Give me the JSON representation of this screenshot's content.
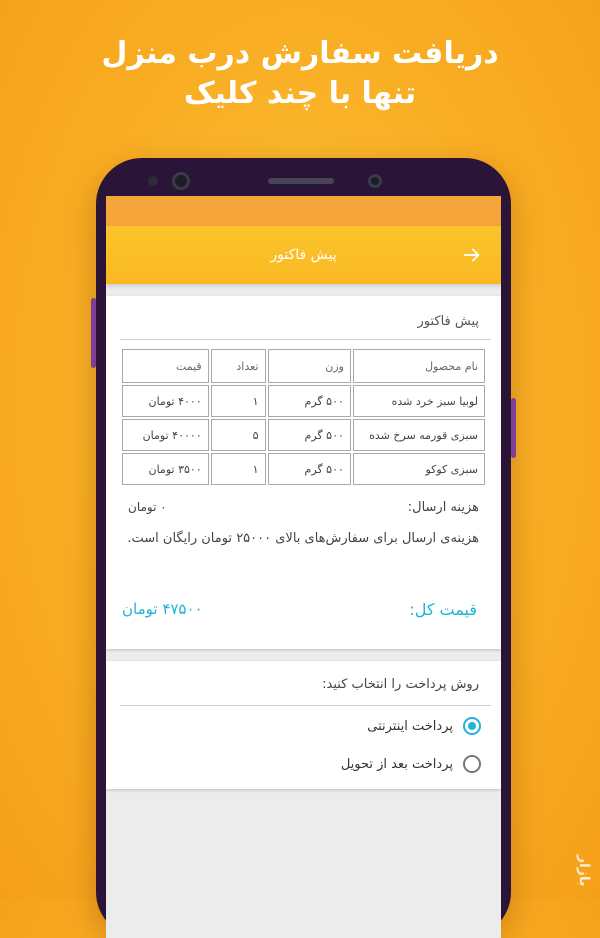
{
  "headline": {
    "line1": "دریافت سفارش درب منزل",
    "line2": "تنها با چند کلیک"
  },
  "appbar": {
    "title": "پیش فاکتور",
    "back_icon": "arrow-right-icon"
  },
  "invoice": {
    "title": "پیش فاکتور",
    "columns": [
      "نام محصول",
      "وزن",
      "تعداد",
      "قیمت"
    ],
    "rows": [
      {
        "name": "لوبیا سبز خرد شده",
        "weight": "۵۰۰ گرم",
        "qty": "۱",
        "price": "۴۰۰۰ تومان"
      },
      {
        "name": "سبزی قورمه سرخ شده",
        "weight": "۵۰۰ گرم",
        "qty": "۵",
        "price": "۴۰۰۰۰ تومان"
      },
      {
        "name": "سبزی کوکو",
        "weight": "۵۰۰ گرم",
        "qty": "۱",
        "price": "۳۵۰۰ تومان"
      }
    ],
    "shipping_label": "هزینه ارسال:",
    "shipping_value": "۰ تومان",
    "shipping_note": "هزینه‌ی ارسال برای سفارش‌های بالای ۲۵۰۰۰ تومان رایگان است.",
    "total_label": "قیمت کل:",
    "total_value": "۴۷۵۰۰ تومان"
  },
  "payment": {
    "title": "روش پرداخت را انتخاب کنید:",
    "options": [
      {
        "label": "پرداخت اینترنتی",
        "selected": true
      },
      {
        "label": "پرداخت بعد از تحویل",
        "selected": false
      }
    ]
  },
  "watermark": "بازار",
  "colors": {
    "accent": "#1fb3d8",
    "appbar": "#f9b822",
    "background": "#f9ad23"
  }
}
